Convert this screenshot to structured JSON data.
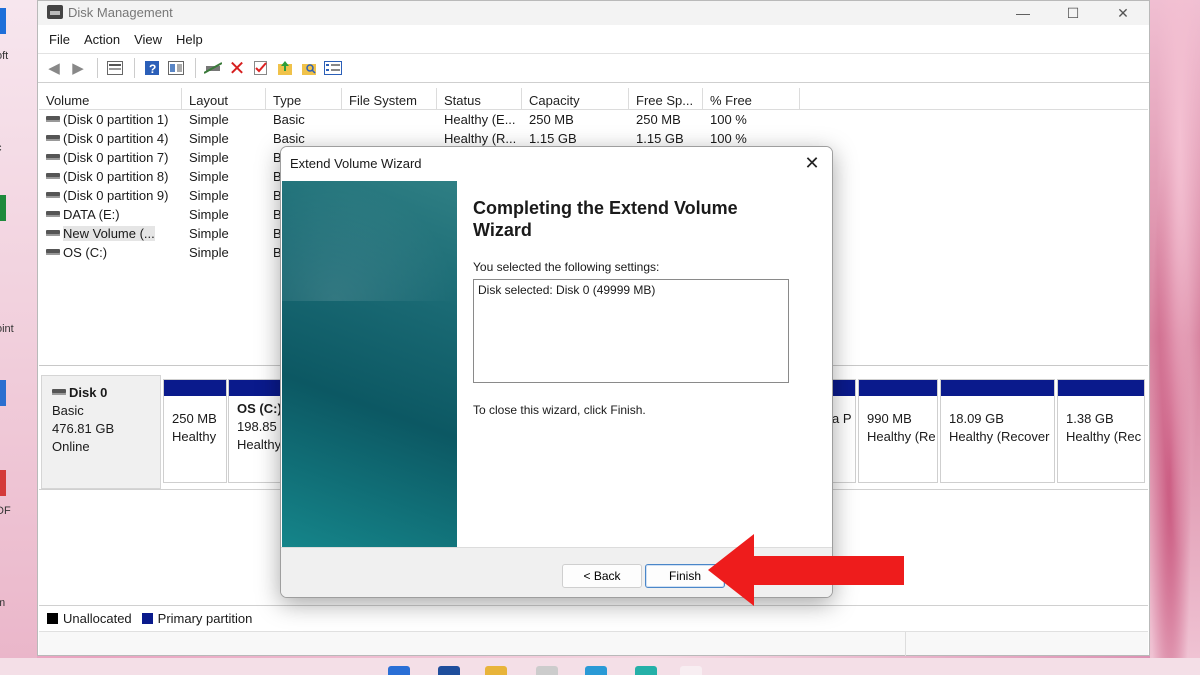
{
  "window": {
    "title": "Disk Management",
    "minimize": "—",
    "maximize": "☐",
    "close": "✕"
  },
  "menu": [
    "File",
    "Action",
    "View",
    "Help"
  ],
  "toolbar": {
    "icons": [
      "back-icon",
      "forward-icon",
      "disk-list-icon",
      "help-icon",
      "properties-icon",
      "connect-icon",
      "delete-icon",
      "check-icon",
      "up-folder-icon",
      "search-folder-icon",
      "settings-list-icon"
    ]
  },
  "volume_list": {
    "columns": [
      "Volume",
      "Layout",
      "Type",
      "File System",
      "Status",
      "Capacity",
      "Free Sp...",
      "% Free"
    ],
    "rows": [
      {
        "volume": "(Disk 0 partition 1)",
        "layout": "Simple",
        "type": "Basic",
        "fs": "",
        "status": "Healthy (E...",
        "capacity": "250 MB",
        "free": "250 MB",
        "pct": "100 %"
      },
      {
        "volume": "(Disk 0 partition 4)",
        "layout": "Simple",
        "type": "Basic",
        "fs": "",
        "status": "Healthy (R...",
        "capacity": "1.15 GB",
        "free": "1.15 GB",
        "pct": "100 %"
      },
      {
        "volume": "(Disk 0 partition 7)",
        "layout": "Simple",
        "type": "B",
        "fs": "",
        "status": "",
        "capacity": "",
        "free": "",
        "pct": ""
      },
      {
        "volume": "(Disk 0 partition 8)",
        "layout": "Simple",
        "type": "B",
        "fs": "",
        "status": "",
        "capacity": "",
        "free": "",
        "pct": ""
      },
      {
        "volume": "(Disk 0 partition 9)",
        "layout": "Simple",
        "type": "B",
        "fs": "",
        "status": "",
        "capacity": "",
        "free": "",
        "pct": ""
      },
      {
        "volume": "DATA (E:)",
        "layout": "Simple",
        "type": "B",
        "fs": "",
        "status": "",
        "capacity": "",
        "free": "",
        "pct": ""
      },
      {
        "volume": "New Volume (...",
        "layout": "Simple",
        "type": "B",
        "fs": "",
        "status": "",
        "capacity": "",
        "free": "",
        "pct": ""
      },
      {
        "volume": "OS (C:)",
        "layout": "Simple",
        "type": "B",
        "fs": "",
        "status": "",
        "capacity": "",
        "free": "",
        "pct": ""
      }
    ]
  },
  "disk": {
    "name": "Disk 0",
    "type": "Basic",
    "size": "476.81 GB",
    "state": "Online"
  },
  "partitions": [
    {
      "line1": "",
      "line2": "250 MB",
      "line3": "Healthy"
    },
    {
      "line1": "OS  (C:)",
      "line2": "198.85 G",
      "line3": "Healthy"
    },
    {
      "line1": "",
      "line2": "",
      "line3": "a P"
    },
    {
      "line1": "",
      "line2": "990 MB",
      "line3": "Healthy (Re"
    },
    {
      "line1": "",
      "line2": "18.09 GB",
      "line3": "Healthy (Recover"
    },
    {
      "line1": "",
      "line2": "1.38 GB",
      "line3": "Healthy (Rec"
    }
  ],
  "legend": {
    "unallocated": "Unallocated",
    "primary": "Primary partition",
    "unallocated_color": "#000000",
    "primary_color": "#0a1a8c"
  },
  "dialog": {
    "title": "Extend Volume Wizard",
    "close": "✕",
    "heading": "Completing the Extend Volume Wizard",
    "subtitle": "You selected the following settings:",
    "settings": "Disk selected: Disk 0 (49999 MB)",
    "close_hint": "To close this wizard, click Finish.",
    "back_label": "< Back",
    "finish_label": "Finish"
  },
  "desktop": {
    "left_labels": [
      "oft",
      "c",
      "oint",
      "DF",
      "m"
    ]
  },
  "annotation_color": "#ee1c1c"
}
